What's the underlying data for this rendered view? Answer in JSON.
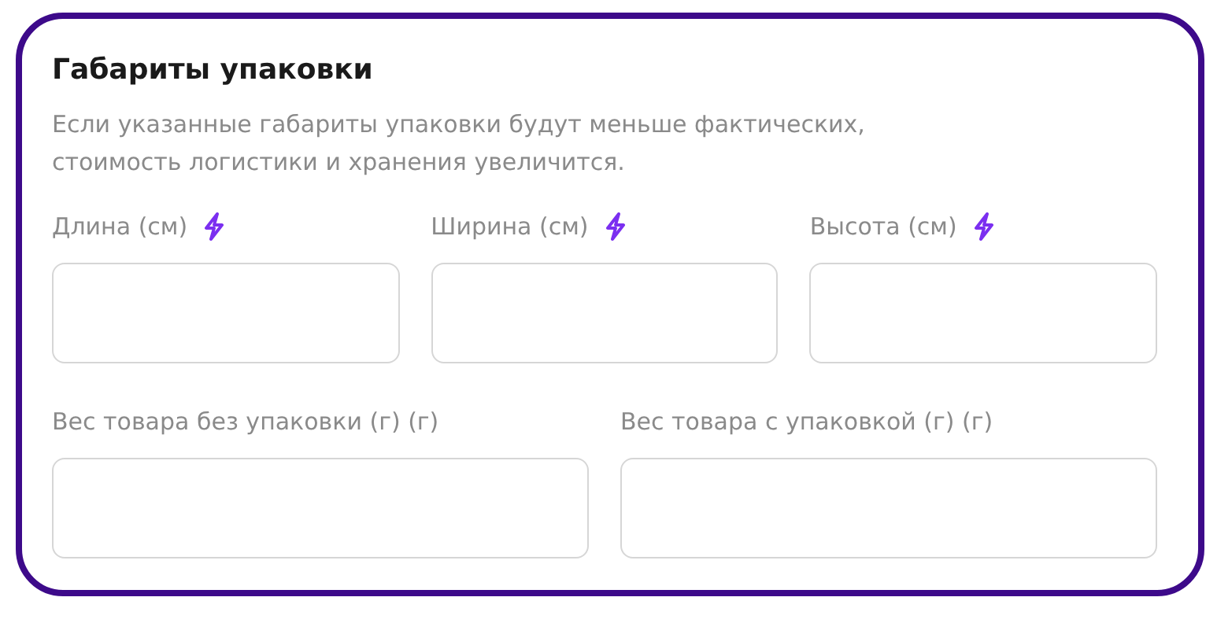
{
  "title": "Габариты упаковки",
  "description": "Если указанные габариты упаковки будут меньше фактических, стоимость логистики и хранения увеличится.",
  "rows": [
    {
      "fields": [
        {
          "label": "Длина (см)",
          "sparkle": true
        },
        {
          "label": "Ширина (см)",
          "sparkle": true
        },
        {
          "label": "Высота (см)",
          "sparkle": true
        }
      ]
    },
    {
      "fields": [
        {
          "label": "Вес товара без упаковки (г) (г)",
          "sparkle": false
        },
        {
          "label": "Вес товара с упаковкой (г) (г)",
          "sparkle": false
        }
      ]
    }
  ]
}
